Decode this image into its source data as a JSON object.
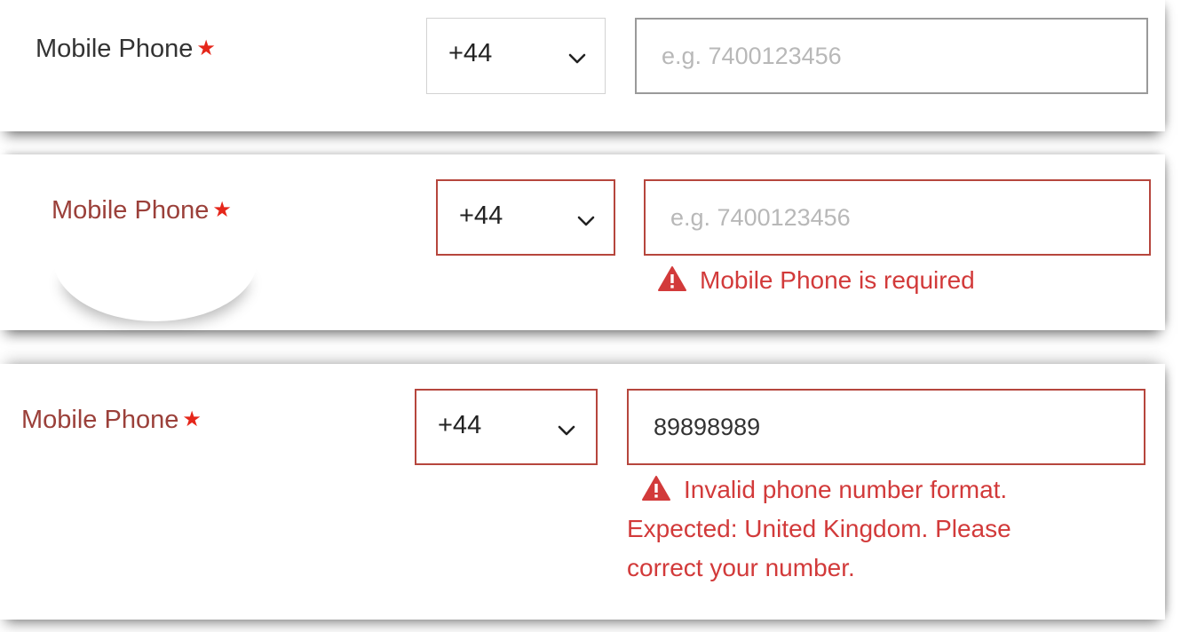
{
  "colors": {
    "label_default": "#333333",
    "label_error": "#9b403a",
    "required_star": "#e5261a",
    "error_text": "#d23a3a",
    "error_border": "#b6463d",
    "placeholder": "#b8b8b8"
  },
  "panels": [
    {
      "state": "default",
      "label": "Mobile Phone",
      "required_marker": "★",
      "country_code": "+44",
      "placeholder": "e.g. 7400123456",
      "value": ""
    },
    {
      "state": "required-error",
      "label": "Mobile Phone",
      "required_marker": "★",
      "country_code": "+44",
      "placeholder": "e.g. 7400123456",
      "value": "",
      "error_lines": [
        "Mobile Phone is required"
      ]
    },
    {
      "state": "format-error",
      "label": "Mobile Phone",
      "required_marker": "★",
      "country_code": "+44",
      "placeholder": "",
      "value": "89898989",
      "error_lines": [
        "Invalid phone number format.",
        "Expected: United Kingdom. Please",
        "correct your number."
      ]
    }
  ],
  "icons": {
    "select_toggle": "chevron-down-icon",
    "error": "warning-triangle-icon"
  }
}
